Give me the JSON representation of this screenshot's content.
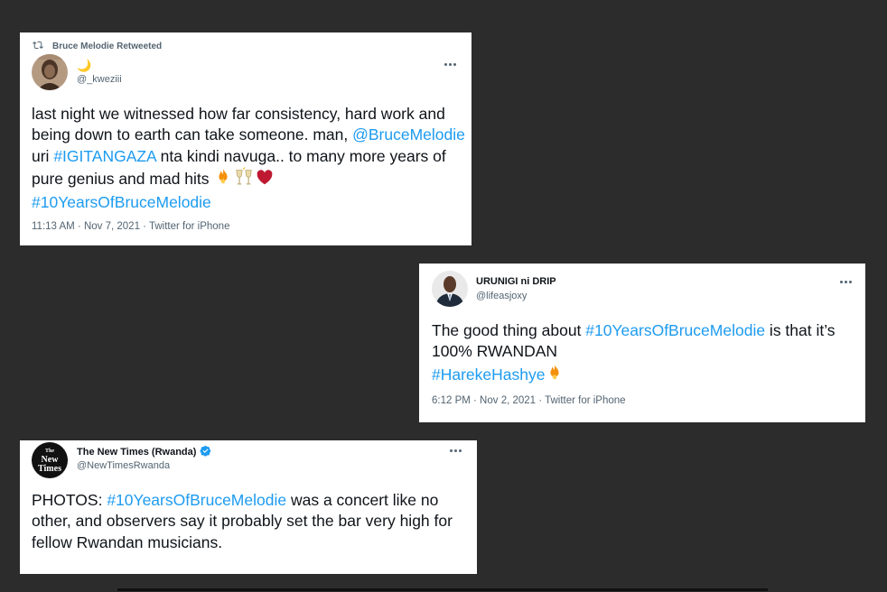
{
  "tweets": [
    {
      "retweet_label": "Bruce Melodie Retweeted",
      "display_name": "🌙",
      "handle": "@_kweziii",
      "text_parts": [
        "last night we witnessed how far consistency, hard work and being down to earth can take someone. man, ",
        "@BruceMelodie",
        " uri ",
        "#IGITANGAZA",
        " nta kindi navuga.. to many more years of pure genius and mad hits ",
        "#10YearsOfBruceMelodie"
      ],
      "emojis": [
        "fire-emoji",
        "clinking-glasses-emoji",
        "heart-emoji"
      ],
      "meta": "11:13 AM · Nov 7, 2021 · Twitter for iPhone"
    },
    {
      "display_name": "URUNIGI ni DRIP",
      "handle": "@lifeasjoxy",
      "text_parts": [
        "The good thing about ",
        "#10YearsOfBruceMelodie",
        " is that it’s 100% RWANDAN",
        "#HarekeHashye"
      ],
      "emojis": [
        "fire-emoji"
      ],
      "meta": "6:12 PM · Nov 2, 2021 · Twitter for iPhone"
    },
    {
      "display_name": "The New Times (Rwanda)",
      "handle": "@NewTimesRwanda",
      "verified": true,
      "avatar_text": [
        "The",
        "New",
        "Times"
      ],
      "text_parts": [
        "PHOTOS: ",
        "#10YearsOfBruceMelodie",
        " was a concert like no other, and observers say it probably set the bar very high for fellow Rwandan musicians."
      ]
    }
  ],
  "colors": {
    "background": "#2c2c2c",
    "card": "#ffffff",
    "text": "#0f1419",
    "secondary": "#536471",
    "link": "#1d9bf0",
    "verified": "#1d9bf0"
  }
}
